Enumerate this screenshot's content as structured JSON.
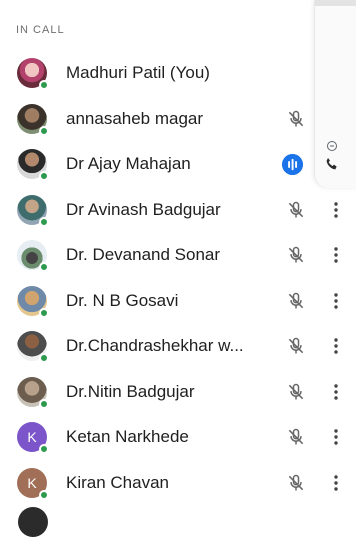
{
  "section": {
    "title": "IN CALL"
  },
  "participants": [
    {
      "name": "Madhuri Patil (You)",
      "avatar": "photo1",
      "mic": "none",
      "more": false
    },
    {
      "name": "annasaheb magar",
      "avatar": "photo2",
      "mic": "muted",
      "more": false
    },
    {
      "name": "Dr Ajay Mahajan",
      "avatar": "photo3",
      "mic": "speaking",
      "more": false
    },
    {
      "name": "Dr Avinash Badgujar",
      "avatar": "photo4",
      "mic": "muted",
      "more": true
    },
    {
      "name": "Dr. Devanand Sonar",
      "avatar": "photo5",
      "mic": "muted",
      "more": true
    },
    {
      "name": "Dr. N B Gosavi",
      "avatar": "photo6",
      "mic": "muted",
      "more": true
    },
    {
      "name": "Dr.Chandrashekhar w...",
      "avatar": "photo7",
      "mic": "muted",
      "more": true
    },
    {
      "name": "Dr.Nitin Badgujar",
      "avatar": "photo8",
      "mic": "muted",
      "more": true
    },
    {
      "name": "Ketan Narkhede",
      "avatar": "letter-purple",
      "initial": "K",
      "mic": "muted",
      "more": true
    },
    {
      "name": "Kiran Chavan",
      "avatar": "letter-brown",
      "initial": "K",
      "mic": "muted",
      "more": true
    }
  ],
  "icons": {
    "mic_muted": "mic-off-icon",
    "speaking": "audio-wave-icon",
    "more": "more-vert-icon",
    "side_phone": "phone-icon",
    "side_small": "minus-circle-icon"
  },
  "colors": {
    "accent": "#1a73e8",
    "online": "#2e9a4d",
    "text": "#1f1f1f",
    "muted_icon": "#666666"
  }
}
